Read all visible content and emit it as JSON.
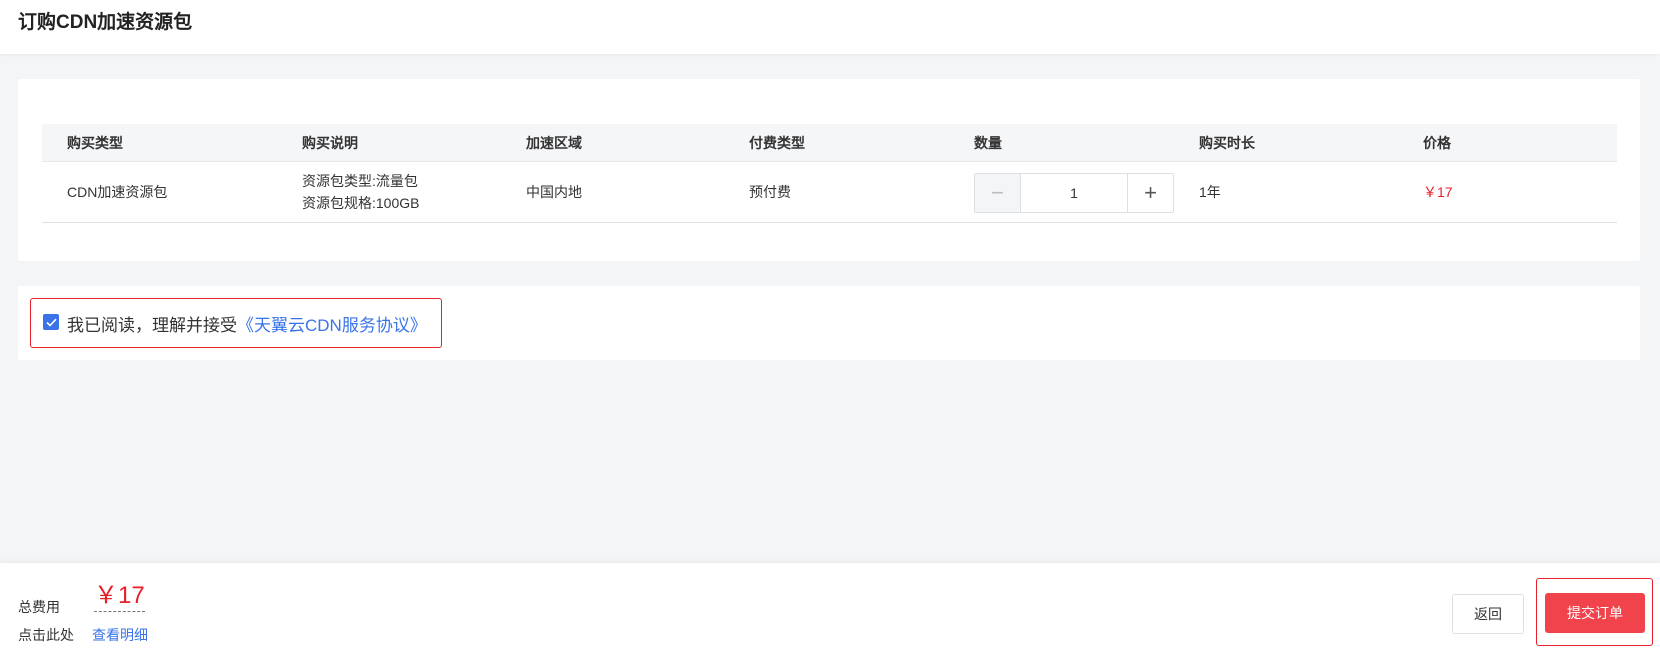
{
  "header": {
    "title": "订购CDN加速资源包"
  },
  "table": {
    "columns": [
      "购买类型",
      "购买说明",
      "加速区域",
      "付费类型",
      "数量",
      "购买时长",
      "价格"
    ],
    "row": {
      "type": "CDN加速资源包",
      "desc_line1": "资源包类型:流量包",
      "desc_line2": "资源包规格:100GB",
      "region": "中国内地",
      "pay_type": "预付费",
      "quantity": "1",
      "minus_symbol": "−",
      "plus_symbol": "+",
      "duration": "1年",
      "price": "￥17"
    }
  },
  "agreement": {
    "text": "我已阅读，理解并接受",
    "link": "《天翼云CDN服务协议》",
    "checked": true,
    "check_color": "#3a73e8"
  },
  "footer": {
    "total_label": "总费用",
    "total_price": "￥17",
    "click_label": "点击此处",
    "detail_link": "查看明细",
    "back_label": "返回",
    "submit_label": "提交订单"
  },
  "colors": {
    "accent": "#3a73e8",
    "price": "#e8202a",
    "submit": "#f0434b"
  }
}
